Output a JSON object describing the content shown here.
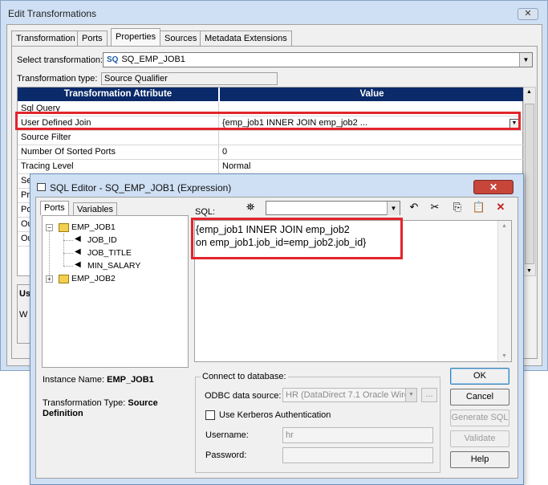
{
  "outer": {
    "title": "Edit Transformations",
    "close_glyph": "✕",
    "tabs": [
      "Transformation",
      "Ports",
      "Properties",
      "Sources",
      "Metadata Extensions"
    ],
    "active_tab": "Properties",
    "select_label": "Select transformation:",
    "select_icon": "SQ",
    "select_value": "SQ_EMP_JOB1",
    "type_label": "Transformation type:",
    "type_value": "Source Qualifier",
    "grid_header_attr": "Transformation Attribute",
    "grid_header_value": "Value",
    "rows": [
      {
        "attr": "Sql Query",
        "value": ""
      },
      {
        "attr": "User Defined Join",
        "value": "{emp_job1 INNER JOIN emp_job2 ..."
      },
      {
        "attr": "Source Filter",
        "value": ""
      },
      {
        "attr": "Number Of Sorted Ports",
        "value": "0"
      },
      {
        "attr": "Tracing Level",
        "value": "Normal"
      }
    ],
    "hidden_row_fragments": [
      "Se",
      "Pr",
      "Po",
      "Ou",
      "Ou"
    ],
    "lower_label_fragment": "Us",
    "lower_text_fragment": "W"
  },
  "sql_editor": {
    "title": "SQL Editor - SQ_EMP_JOB1 (Expression)",
    "close_glyph": "✕",
    "tabs": [
      "Ports",
      "Variables"
    ],
    "active_tab": "Ports",
    "tree": [
      {
        "label": "EMP_JOB1",
        "kind": "table",
        "expanded": true
      },
      {
        "label": "JOB_ID",
        "kind": "port"
      },
      {
        "label": "JOB_TITLE",
        "kind": "port"
      },
      {
        "label": "MIN_SALARY",
        "kind": "port"
      },
      {
        "label": "EMP_JOB2",
        "kind": "table",
        "expanded": false
      }
    ],
    "instance_label": "Instance Name:",
    "instance_value": "EMP_JOB1",
    "type_label": "Transformation Type:",
    "type_value_1": "Source",
    "type_value_2": "Definition",
    "sql_label": "SQL:",
    "sql_line_1": "{emp_job1 INNER JOIN emp_job2",
    "sql_line_2": "on emp_job1.job_id=emp_job2.job_id}",
    "connect_legend": "Connect to database:",
    "odbc_label": "ODBC data source:",
    "odbc_value": "HR (DataDirect 7.1 Oracle Wire",
    "browse_label": "...",
    "kerberos_label": "Use Kerberos Authentication",
    "username_label": "Username:",
    "username_value": "hr",
    "password_label": "Password:",
    "password_value": "",
    "buttons": {
      "ok": "OK",
      "cancel": "Cancel",
      "generate_sql": "Generate SQL",
      "validate": "Validate",
      "help": "Help"
    }
  },
  "colors": {
    "grid_header": "#0a2a6a",
    "highlight_red": "#e3242b",
    "close_red": "#c8453a"
  }
}
